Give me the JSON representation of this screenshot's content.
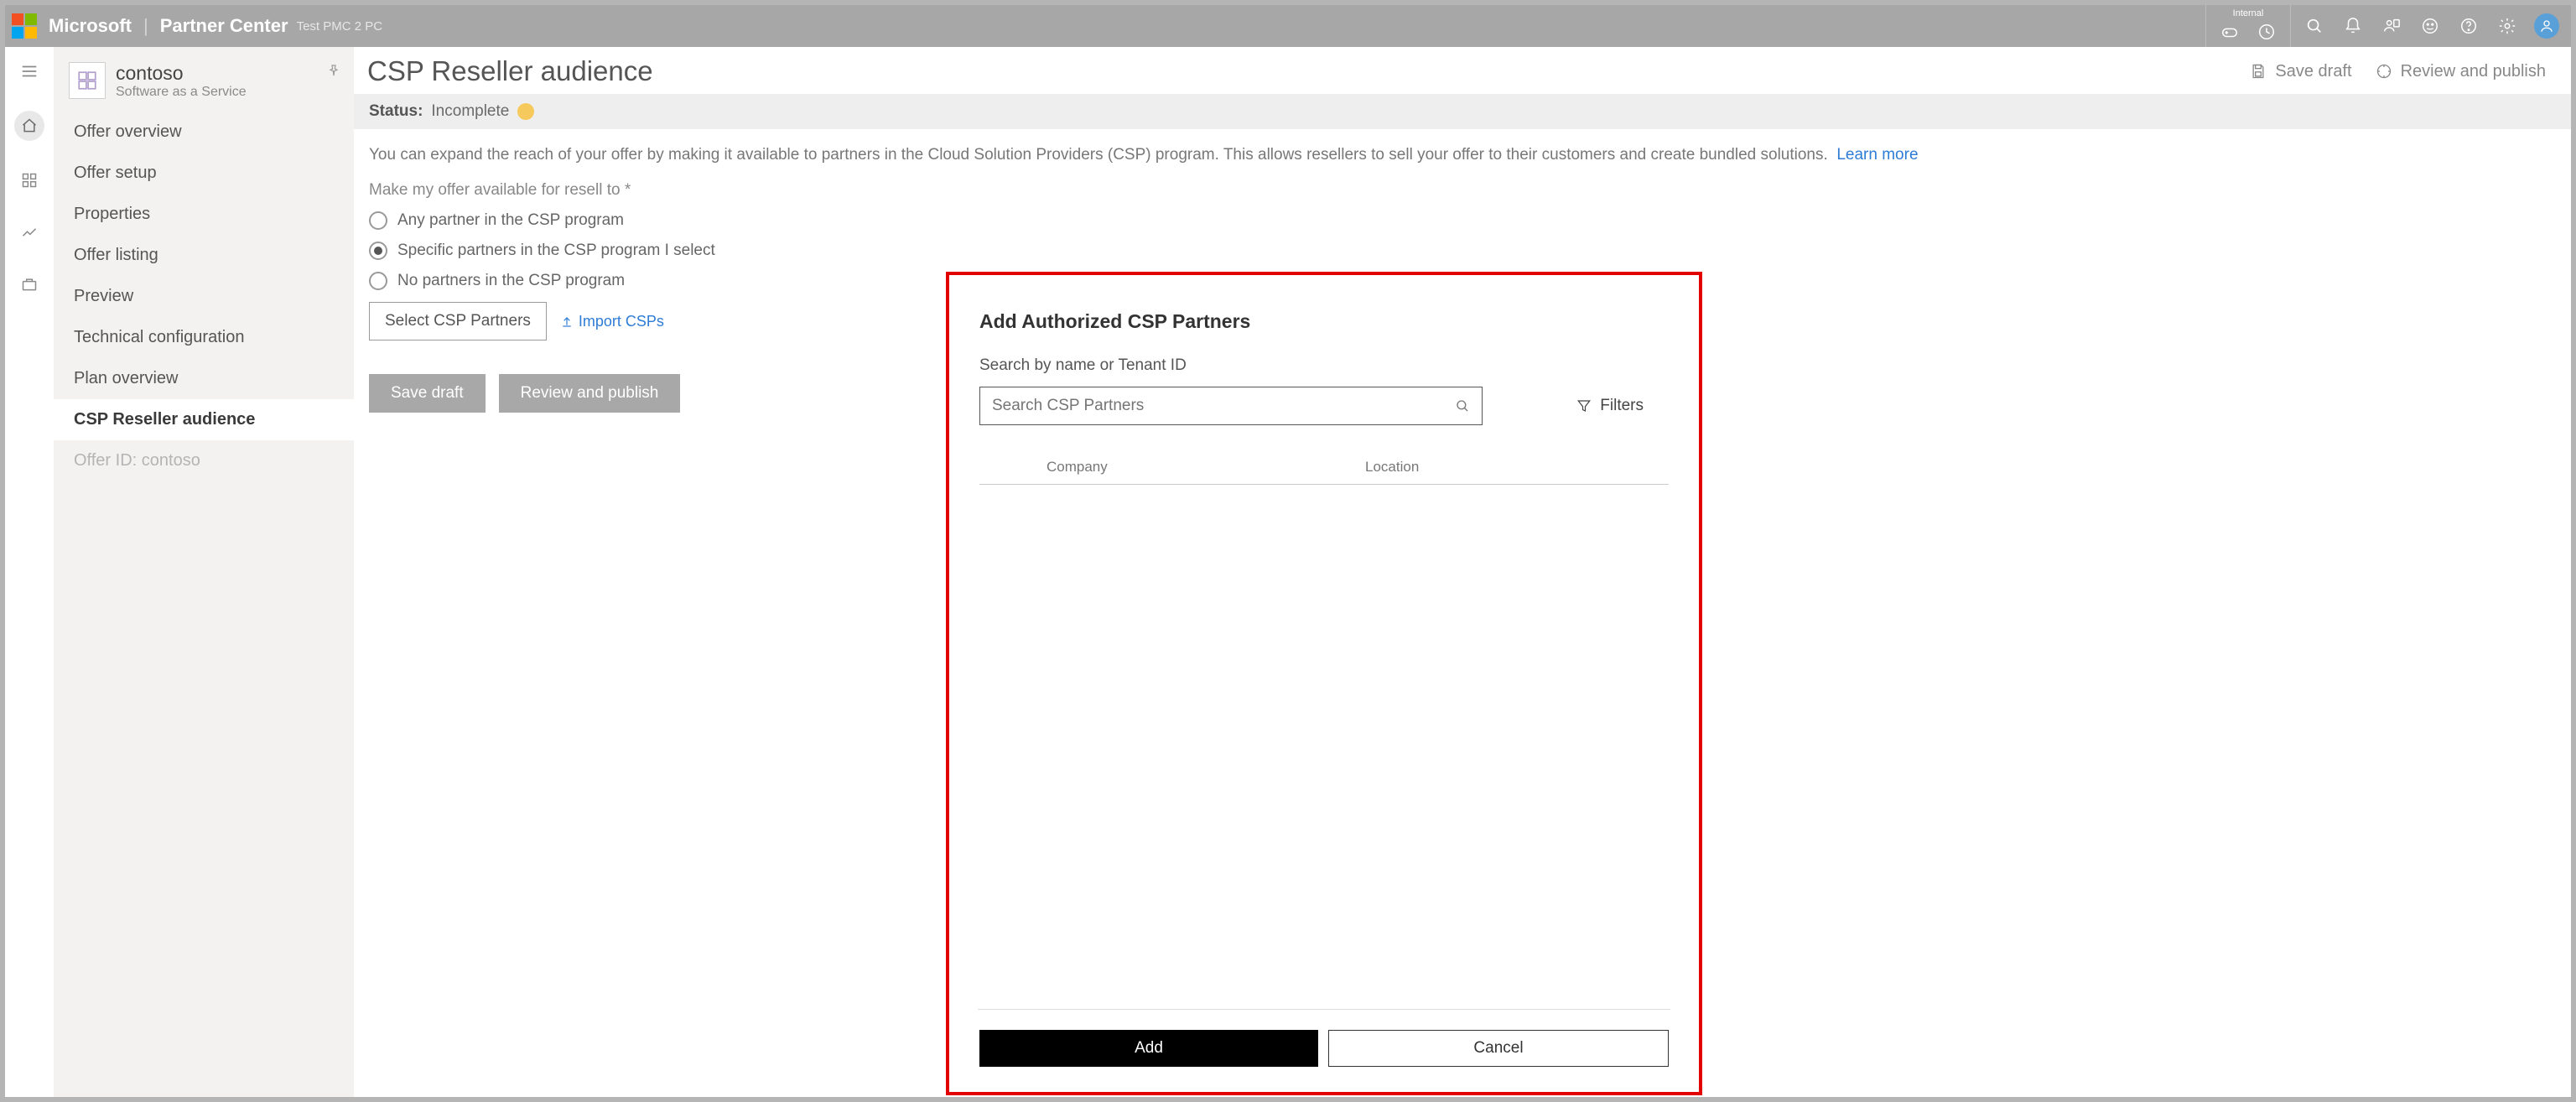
{
  "topbar": {
    "brand": "Microsoft",
    "product": "Partner Center",
    "env": "Test PMC 2 PC",
    "internal_label": "Internal"
  },
  "topbar_icons": {
    "game": "game-controller-icon",
    "clock": "clock-icon",
    "search": "search-icon",
    "bell": "bell-icon",
    "person_doc": "person-card-icon",
    "face": "face-icon",
    "help": "help-icon",
    "settings": "gear-icon"
  },
  "rail": {
    "items": [
      {
        "name": "menu-icon"
      },
      {
        "name": "home-icon",
        "active": true
      },
      {
        "name": "grid-icon"
      },
      {
        "name": "chart-icon"
      },
      {
        "name": "briefcase-icon"
      }
    ]
  },
  "sidenav": {
    "offer_name": "contoso",
    "offer_type": "Software as a Service",
    "items": [
      {
        "label": "Offer overview",
        "key": "overview"
      },
      {
        "label": "Offer setup",
        "key": "setup"
      },
      {
        "label": "Properties",
        "key": "properties"
      },
      {
        "label": "Offer listing",
        "key": "listing"
      },
      {
        "label": "Preview",
        "key": "preview"
      },
      {
        "label": "Technical configuration",
        "key": "tech"
      },
      {
        "label": "Plan overview",
        "key": "plans"
      },
      {
        "label": "CSP Reseller audience",
        "key": "csp",
        "active": true
      },
      {
        "label": "Offer ID: contoso",
        "key": "id",
        "dim": true
      }
    ]
  },
  "page": {
    "title": "CSP Reseller audience",
    "save_draft": "Save draft",
    "review_publish": "Review and publish",
    "status_label": "Status:",
    "status_value": "Incomplete",
    "description": "You can expand the reach of your offer by making it available to partners in the Cloud Solution Providers (CSP) program. This allows resellers to sell your offer to their customers and create bundled solutions.",
    "learn_more": "Learn more",
    "field_label": "Make my offer available for resell to *",
    "radios": [
      {
        "label": "Any partner in the CSP program",
        "selected": false
      },
      {
        "label": "Specific partners in the CSP program I select",
        "selected": true
      },
      {
        "label": "No partners in the CSP program",
        "selected": false
      }
    ],
    "select_partners_btn": "Select CSP Partners",
    "import_link": "Import CSPs",
    "save_draft_btn": "Save draft",
    "review_btn": "Review and publish"
  },
  "modal": {
    "title": "Add Authorized CSP Partners",
    "subtitle": "Search by name or Tenant ID",
    "search_placeholder": "Search CSP Partners",
    "filters": "Filters",
    "col_company": "Company",
    "col_location": "Location",
    "add_btn": "Add",
    "cancel_btn": "Cancel"
  }
}
